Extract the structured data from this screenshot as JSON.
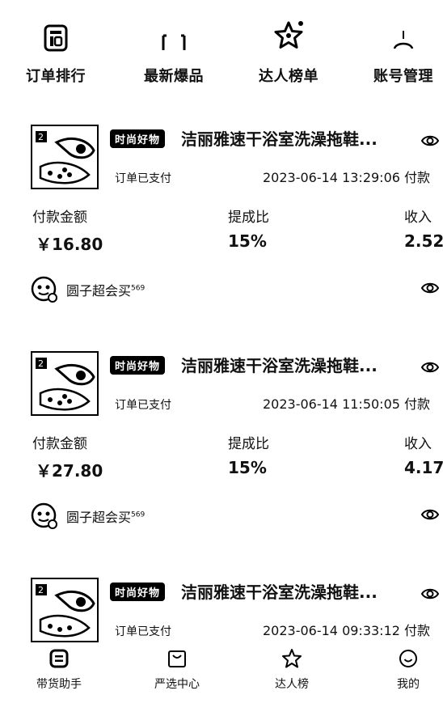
{
  "top_nav": [
    {
      "label": "订单排行",
      "icon": "clipboard-icon"
    },
    {
      "label": "最新爆品",
      "icon": "bag-icon"
    },
    {
      "label": "达人榜单",
      "icon": "star-icon"
    },
    {
      "label": "账号管理",
      "icon": "user-icon"
    }
  ],
  "labels": {
    "amount": "付款金额",
    "rate": "提成比",
    "income": "收入"
  },
  "orders": [
    {
      "badge": "时尚好物",
      "title": "洁丽雅速干浴室洗澡拖鞋...",
      "status": "订单已支付",
      "time": "2023-06-14 13:29:06 付款",
      "amount": "￥16.80",
      "rate": "15%",
      "income": "2.52",
      "user": "圆子超会买",
      "user_sup": "569"
    },
    {
      "badge": "时尚好物",
      "title": "洁丽雅速干浴室洗澡拖鞋...",
      "status": "订单已支付",
      "time": "2023-06-14 11:50:05 付款",
      "amount": "￥27.80",
      "rate": "15%",
      "income": "4.17",
      "user": "圆子超会买",
      "user_sup": "569"
    },
    {
      "badge": "时尚好物",
      "title": "洁丽雅速干浴室洗澡拖鞋...",
      "status": "订单已支付",
      "time": "2023-06-14 09:33:12 付款"
    }
  ],
  "bottom_nav": [
    {
      "label": "带货助手",
      "icon": "assistant-icon"
    },
    {
      "label": "严选中心",
      "icon": "bag-icon"
    },
    {
      "label": "达人榜",
      "icon": "star-icon"
    },
    {
      "label": "我的",
      "icon": "smile-icon"
    }
  ]
}
